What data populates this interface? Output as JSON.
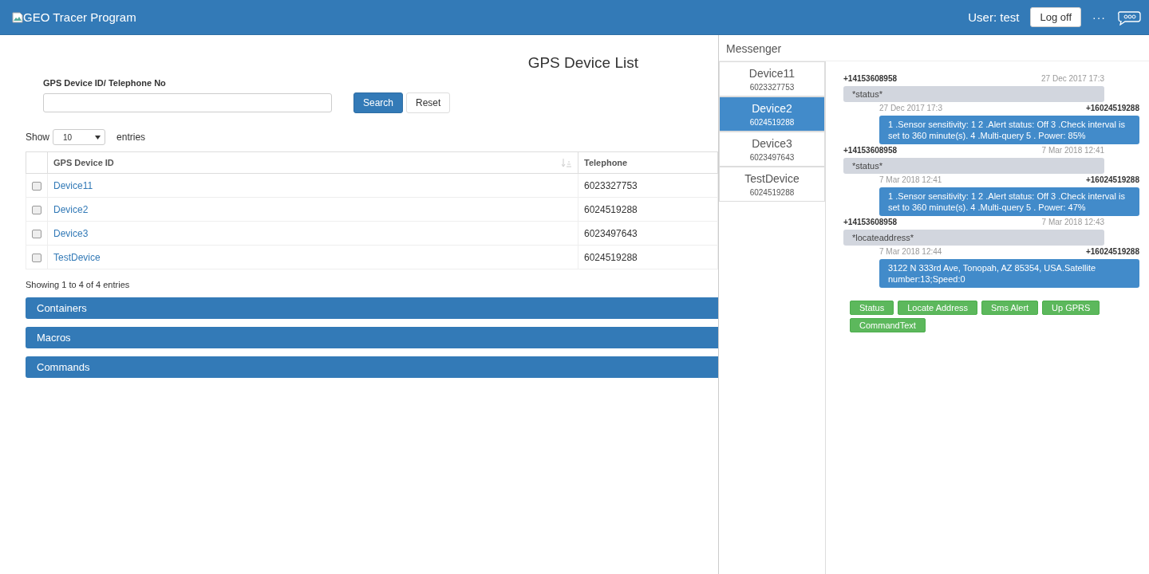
{
  "header": {
    "title": "GEO Tracer Program",
    "user": "User: test",
    "logoff": "Log off",
    "more": "···"
  },
  "page_title": "GPS Device List",
  "search": {
    "label": "GPS Device ID/ Telephone No",
    "buttons": [
      {
        "label": "Search",
        "kind": "primary"
      },
      {
        "label": "Reset",
        "kind": "default"
      }
    ]
  },
  "length": {
    "show": "Show",
    "value": "10",
    "entries": "entries"
  },
  "table": {
    "columns": [
      "GPS Device ID",
      "Telephone"
    ],
    "rows": [
      {
        "id": "Device11",
        "telephone": "6023327753",
        "checked": false
      },
      {
        "id": "Device2",
        "telephone": "6024519288",
        "checked": false
      },
      {
        "id": "Device3",
        "telephone": "6023497643",
        "checked": false
      },
      {
        "id": "TestDevice",
        "telephone": "6024519288",
        "checked": false
      }
    ]
  },
  "info": "Showing 1 to 4 of 4 entries",
  "panels": [
    "Containers",
    "Macros",
    "Commands"
  ],
  "messenger": {
    "title": "Messenger",
    "devices": [
      {
        "name": "Device11",
        "phone": "6023327753",
        "selected": false
      },
      {
        "name": "Device2",
        "phone": "6024519288",
        "selected": true
      },
      {
        "name": "Device3",
        "phone": "6023497643",
        "selected": false
      },
      {
        "name": "TestDevice",
        "phone": "6024519288",
        "selected": false
      }
    ],
    "messages": [
      {
        "kind": "in",
        "sender": "+14153608958",
        "time": "27 Dec 2017 17:3",
        "text": "*status*"
      },
      {
        "kind": "out",
        "sender": "+16024519288",
        "time": "27 Dec 2017 17:3",
        "text": "1 .Sensor sensitivity: 1 2 .Alert status: Off 3 .Check interval is set to 360 minute(s). 4 .Multi-query 5 . Power: 85%"
      },
      {
        "kind": "in",
        "sender": "+14153608958",
        "time": "7 Mar 2018 12:41",
        "text": "*status*"
      },
      {
        "kind": "out",
        "sender": "+16024519288",
        "time": "7 Mar 2018 12:41",
        "text": "1 .Sensor sensitivity: 1 2 .Alert status: Off 3 .Check interval is set to 360 minute(s). 4 .Multi-query 5 . Power: 47%"
      },
      {
        "kind": "in",
        "sender": "+14153608958",
        "time": "7 Mar 2018 12:43",
        "text": "*locateaddress*"
      },
      {
        "kind": "out",
        "sender": "+16024519288",
        "time": "7 Mar 2018 12:44",
        "text": "3122 N 333rd Ave, Tonopah, AZ 85354, USA.Satellite number:13;Speed:0"
      }
    ],
    "commands": [
      "Status",
      "Locate Address",
      "Sms Alert",
      "Up GPRS",
      "CommandText"
    ]
  }
}
